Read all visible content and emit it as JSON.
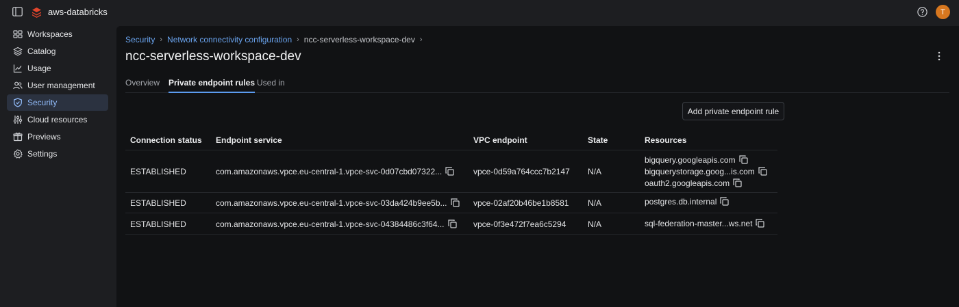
{
  "topbar": {
    "workspace_name": "aws-databricks",
    "avatar_initial": "T"
  },
  "sidebar": {
    "items": [
      {
        "label": "Workspaces",
        "icon": "workspaces-icon"
      },
      {
        "label": "Catalog",
        "icon": "catalog-icon"
      },
      {
        "label": "Usage",
        "icon": "usage-icon"
      },
      {
        "label": "User management",
        "icon": "users-icon"
      },
      {
        "label": "Security",
        "icon": "shield-icon",
        "active": true
      },
      {
        "label": "Cloud resources",
        "icon": "cloud-resources-icon"
      },
      {
        "label": "Previews",
        "icon": "previews-icon"
      },
      {
        "label": "Settings",
        "icon": "gear-icon"
      }
    ]
  },
  "breadcrumb": {
    "items": [
      "Security",
      "Network connectivity configuration",
      "ncc-serverless-workspace-dev"
    ]
  },
  "page": {
    "title": "ncc-serverless-workspace-dev"
  },
  "tabs": [
    "Overview",
    "Private endpoint rules",
    "Used in"
  ],
  "actions": {
    "add_rule_label": "Add private endpoint rule"
  },
  "table": {
    "columns": [
      "Connection status",
      "Endpoint service",
      "VPC endpoint",
      "State",
      "Resources"
    ],
    "rows": [
      {
        "status": "ESTABLISHED",
        "service": "com.amazonaws.vpce.eu-central-1.vpce-svc-0d07cbd07322...",
        "vpc": "vpce-0d59a764ccc7b2147",
        "state": "N/A",
        "resources": [
          "bigquery.googleapis.com",
          "bigquerystorage.goog...is.com",
          "oauth2.googleapis.com"
        ]
      },
      {
        "status": "ESTABLISHED",
        "service": "com.amazonaws.vpce.eu-central-1.vpce-svc-03da424b9ee5b...",
        "vpc": "vpce-02af20b46be1b8581",
        "state": "N/A",
        "resources": [
          "postgres.db.internal"
        ]
      },
      {
        "status": "ESTABLISHED",
        "service": "com.amazonaws.vpce.eu-central-1.vpce-svc-04384486c3f64...",
        "vpc": "vpce-0f3e472f7ea6c5294",
        "state": "N/A",
        "resources": [
          "sql-federation-master...ws.net"
        ]
      }
    ]
  },
  "colors": {
    "accent": "#5b9bf0",
    "link": "#6aa4ef",
    "avatar": "#d7771f"
  }
}
